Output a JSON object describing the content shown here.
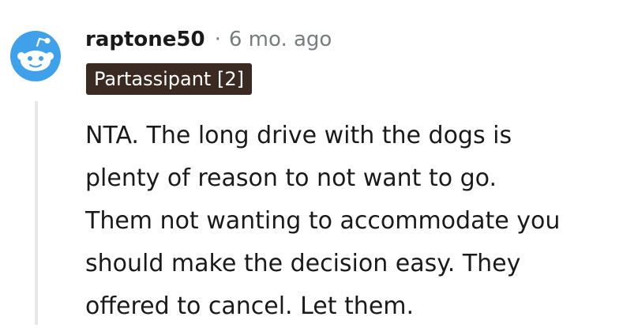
{
  "comment": {
    "author": "raptone50",
    "separator": "·",
    "time_ago": "6 mo. ago",
    "flair": "Partassipant [2]",
    "avatar_icon": "reddit-snoo-avatar-icon",
    "body_lines": [
      "NTA. The long drive with the dogs is",
      "plenty of reason to not want to go.",
      "Them not wanting to accommodate you",
      "should make the decision easy. They",
      "offered to cancel. Let them."
    ]
  },
  "colors": {
    "avatar_blue": "#3fa1ea",
    "flair_background": "#3b2a22",
    "thread_line": "#e5e7e8",
    "meta_text": "#787c7e"
  }
}
